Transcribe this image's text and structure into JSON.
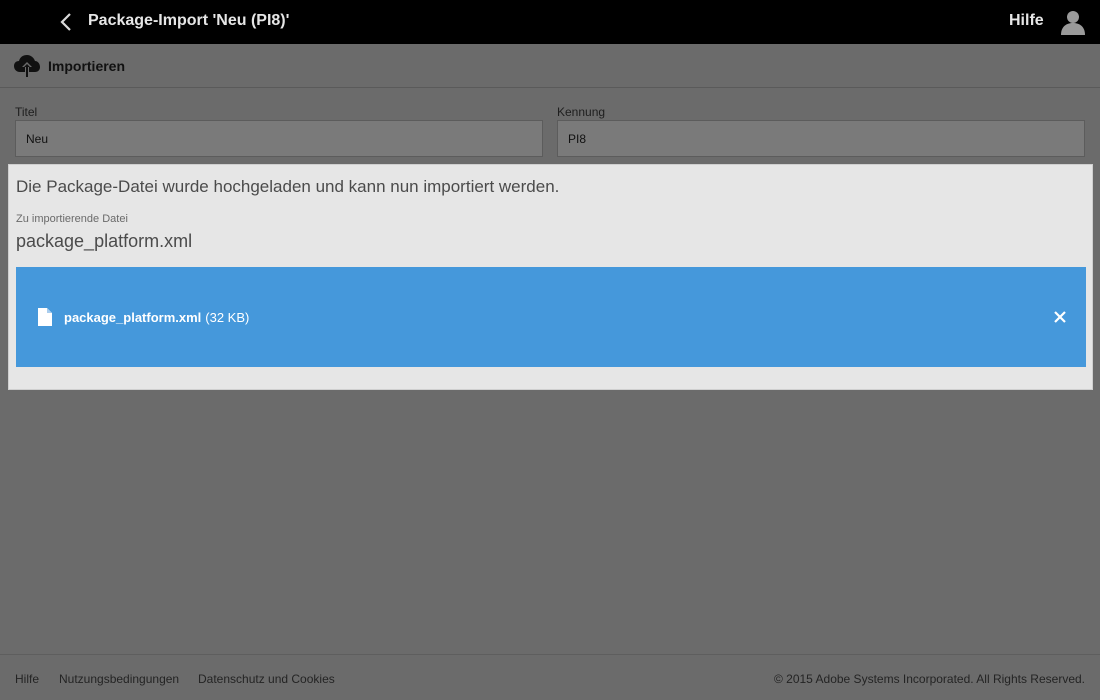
{
  "header": {
    "title": "Package-Import 'Neu (PI8)'",
    "help_label": "Hilfe",
    "icons": {
      "back": "chevron-left-icon",
      "user": "user-icon"
    }
  },
  "toolbar": {
    "import_label": "Importieren",
    "import_icon": "cloud-upload-icon"
  },
  "form": {
    "title_label": "Titel",
    "title_value": "Neu",
    "id_label": "Kennung",
    "id_value": "PI8"
  },
  "dialog": {
    "message": "Die Package-Datei wurde hochgeladen und kann nun importiert werden.",
    "file_label": "Zu importierende Datei",
    "file_name": "package_platform.xml",
    "upload": {
      "file_name": "package_platform.xml",
      "file_size": "(32 KB)",
      "bar_color": "#4598db",
      "icons": {
        "file": "file-icon",
        "remove": "close-icon"
      }
    }
  },
  "footer": {
    "links": [
      "Hilfe",
      "Nutzungsbedingungen",
      "Datenschutz und Cookies"
    ],
    "copyright": "© 2015 Adobe Systems Incorporated. All Rights Reserved."
  }
}
